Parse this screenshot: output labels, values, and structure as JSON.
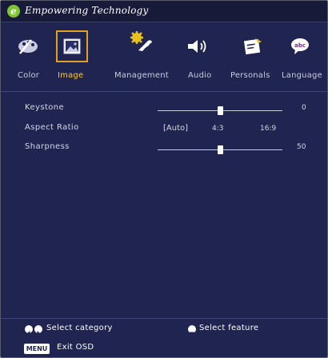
{
  "title": "Empowering Technology",
  "logo_letter": "e",
  "tabs": [
    {
      "label": "Color",
      "icon": "color-palette-icon"
    },
    {
      "label": "Image",
      "icon": "image-icon",
      "active": true
    },
    {
      "label": "Management",
      "icon": "wrench-gear-icon"
    },
    {
      "label": "Audio",
      "icon": "speaker-icon"
    },
    {
      "label": "Personals",
      "icon": "personal-icon"
    },
    {
      "label": "Language",
      "icon": "language-bubble-icon"
    }
  ],
  "settings": {
    "keystone": {
      "label": "Keystone",
      "value": "0",
      "level": 0.5
    },
    "aspect_ratio": {
      "label": "Aspect Ratio",
      "options": [
        "[Auto]",
        "4:3",
        "16:9"
      ],
      "selected": "[Auto]"
    },
    "sharpness": {
      "label": "Sharpness",
      "value": "50",
      "level": 0.5
    }
  },
  "footer": {
    "select_category": "Select category",
    "select_feature": "Select feature",
    "menu_key": "MENU",
    "exit": "Exit OSD"
  },
  "colors": {
    "background": "#1f2451",
    "accent": "#e0a020",
    "active_label": "#ffcc33",
    "logo": "#7fc433"
  }
}
